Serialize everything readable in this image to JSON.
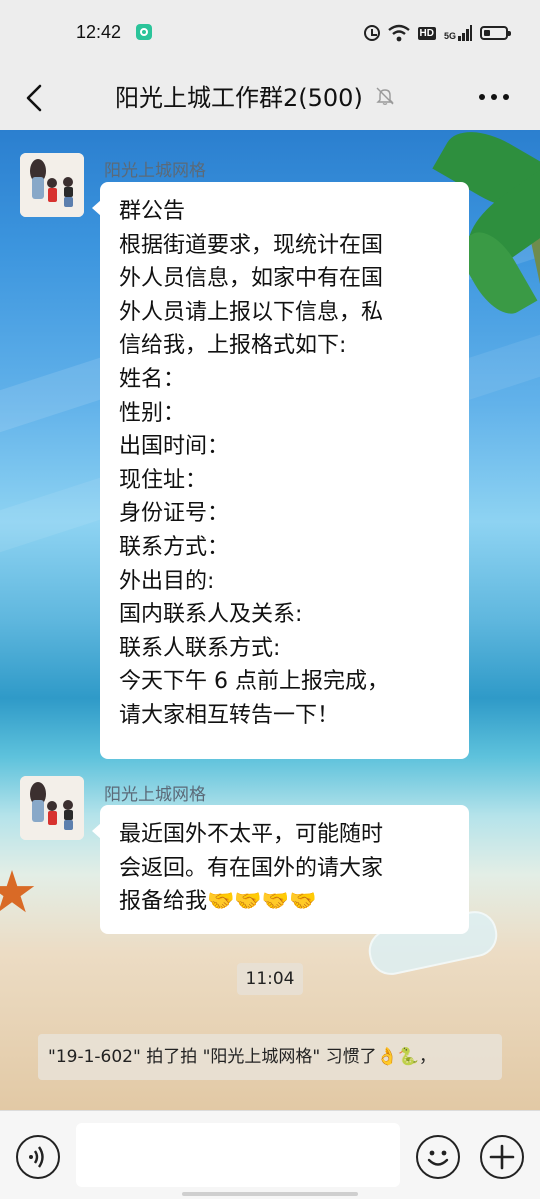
{
  "status_bar": {
    "time": "12:42",
    "icons": [
      "alarm-icon",
      "wifi-icon",
      "hd-icon",
      "signal-5g-icon",
      "battery-icon"
    ],
    "hd_label": "HD",
    "network_label": "5G"
  },
  "header": {
    "title": "阳光上城工作群2(500)",
    "back_icon": "chevron-left-icon",
    "mute_icon": "bell-muted-icon",
    "more_icon": "more-dots-icon"
  },
  "messages": [
    {
      "sender": "阳光上城网格",
      "lines": [
        "群公告",
        "根据街道要求，现统计在国",
        "外人员信息，如家中有在国",
        "外人员请上报以下信息，私",
        "信给我，上报格式如下:",
        "姓名：",
        "性别：",
        "出国时间：",
        "现住址：",
        "身份证号：",
        "联系方式：",
        "外出目的:",
        "国内联系人及关系:",
        "联系人联系方式:",
        "今天下午 6 点前上报完成，",
        "请大家相互转告一下！"
      ]
    },
    {
      "sender": "阳光上城网格",
      "lines": [
        "最近国外不太平，可能随时",
        "会返回。有在国外的请大家",
        "报备给我🤝🤝🤝🤝"
      ]
    }
  ],
  "timestamp": "11:04",
  "system_message": "\"19-1-602\" 拍了拍 \"阳光上城网格\" 习惯了👌🐍，",
  "input_bar": {
    "voice_icon": "voice-icon",
    "emoji_icon": "emoji-icon",
    "plus_icon": "plus-icon",
    "placeholder": ""
  },
  "colors": {
    "app_bg": "#ededed",
    "bubble": "#ffffff",
    "sender_name": "#5b6a78"
  }
}
